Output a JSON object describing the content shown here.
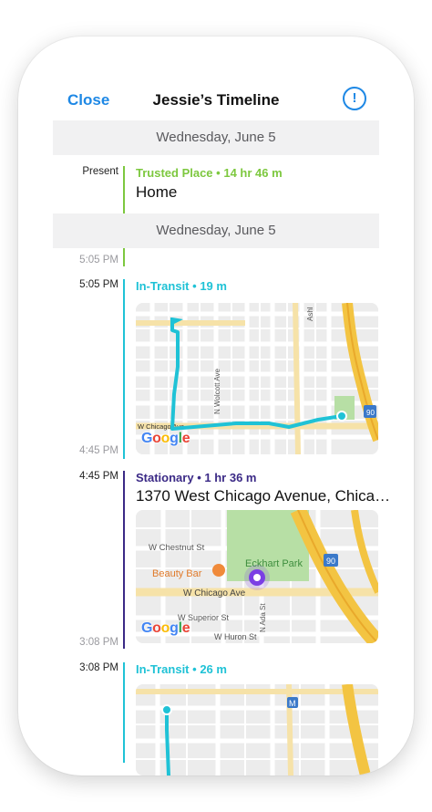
{
  "header": {
    "close_label": "Close",
    "title": "Jessie’s Timeline",
    "info_glyph": "!"
  },
  "colors": {
    "accent_blue": "#1e88e5",
    "trusted_green": "#7dc83f",
    "transit_cyan": "#1fc2d6",
    "stationary_purple": "#3b2a86",
    "poi_purple": "#7b3fe4"
  },
  "dates": [
    "Wednesday, June 5",
    "Wednesday, June 5"
  ],
  "entries": [
    {
      "start": "Present",
      "end": "5:05 PM",
      "tag": "Trusted Place",
      "duration": "14 hr 46 m",
      "place": "Home"
    },
    {
      "start": "5:05 PM",
      "end": "4:45 PM",
      "tag": "In-Transit",
      "duration": "19 m",
      "map": {
        "labels": [
          "W Chicago Ave",
          "N Wolcott Ave",
          "Ashl",
          "90"
        ]
      }
    },
    {
      "start": "4:45 PM",
      "end": "3:08 PM",
      "tag": "Stationary",
      "duration": "1 hr 36 m",
      "place": "1370 West Chicago Avenue, Chica…",
      "map": {
        "labels": [
          "W Chestnut St",
          "Eckhart Park",
          "Beauty Bar",
          "W Chicago Ave",
          "W Superior St",
          "W Huron St",
          "N Ada St",
          "90"
        ]
      }
    },
    {
      "start": "3:08 PM",
      "tag": "In-Transit",
      "duration": "26 m",
      "map": {
        "labels": [
          "M"
        ]
      }
    }
  ],
  "map_brand": "Google",
  "separator": "•"
}
